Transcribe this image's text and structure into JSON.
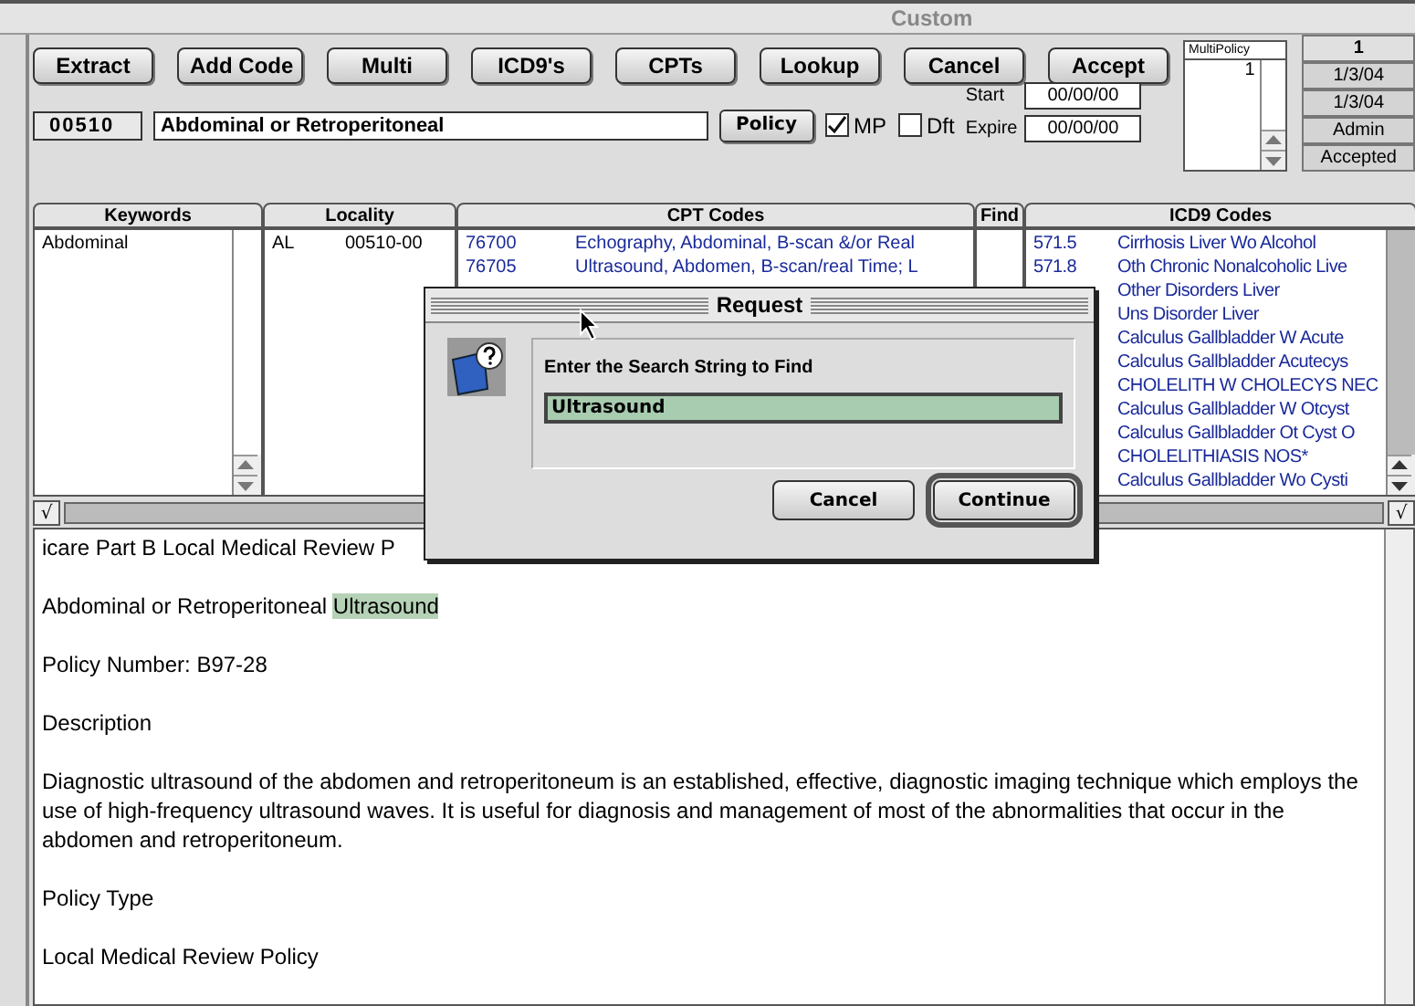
{
  "window": {
    "title": "Custom"
  },
  "toolbar": [
    "Extract",
    "Add Code",
    "Multi",
    "ICD9's",
    "CPTs",
    "Lookup",
    "Cancel",
    "Accept"
  ],
  "record": {
    "code": "00510",
    "title": "Abdominal or Retroperitoneal",
    "policy_button": "Policy",
    "options": [
      {
        "label": "MP",
        "checked": true
      },
      {
        "label": "Dft",
        "checked": false
      }
    ],
    "dates": [
      {
        "label": "Start",
        "value": "00/00/00"
      },
      {
        "label": "Expire",
        "value": "00/00/00"
      }
    ]
  },
  "multi_policy": {
    "header": "MultiPolicy",
    "items": [
      "1"
    ]
  },
  "status": [
    "1",
    "1/3/04",
    "1/3/04",
    "Admin",
    "Accepted"
  ],
  "table": {
    "columns": [
      "Keywords",
      "Locality",
      "CPT Codes",
      "Find",
      "ICD9 Codes"
    ],
    "keywords": [
      "Abdominal"
    ],
    "localities": [
      {
        "state": "AL",
        "code": "00510-00"
      }
    ],
    "cpt_rows": [
      {
        "code": "76700",
        "description": "Echography, Abdominal, B-scan &/or Real"
      },
      {
        "code": "76705",
        "description": "Ultrasound, Abdomen, B-scan/real Time; L"
      }
    ],
    "icd9_rows": [
      {
        "code": "571.5",
        "description": "Cirrhosis Liver Wo Alcohol"
      },
      {
        "code": "571.8",
        "description": "Oth Chronic Nonalcoholic Live"
      },
      {
        "description": "Other Disorders Liver"
      },
      {
        "description": "Uns Disorder Liver"
      },
      {
        "description": "Calculus Gallbladder W Acute"
      },
      {
        "description": "Calculus Gallbladder Acutecys"
      },
      {
        "description": "CHOLELITH W CHOLECYS NEC"
      },
      {
        "description": "Calculus Gallbladder W Otcyst"
      },
      {
        "description": "Calculus Gallbladder Ot Cyst O"
      },
      {
        "description": "CHOLELITHIASIS NOS*"
      },
      {
        "description": "Calculus Gallbladder Wo Cysti"
      }
    ]
  },
  "check_buttons": [
    "√",
    "√"
  ],
  "document": [
    {
      "text": "icare Part B Local Medical Review P"
    },
    {
      "text": "Abdominal or Retroperitoneal ",
      "highlight": "Ultrasound"
    },
    {
      "text": "Policy Number: B97-28"
    },
    {
      "text": "Description"
    },
    {
      "text": "Diagnostic ultrasound of the abdomen and retroperitoneum is an established, effective, diagnostic imaging technique which employs the use of high-frequency ultrasound waves. It is useful for diagnosis and management of most of the abnormalities that occur in the abdomen and retroperitoneum."
    },
    {
      "text": "Policy Type"
    },
    {
      "text": "Local Medical Review Policy"
    }
  ],
  "dialog": {
    "title": "Request",
    "prompt": "Enter the Search String to Find",
    "value": "Ultrasound",
    "buttons": [
      {
        "label": "Cancel",
        "default": false
      },
      {
        "label": "Continue",
        "default": true
      }
    ]
  }
}
